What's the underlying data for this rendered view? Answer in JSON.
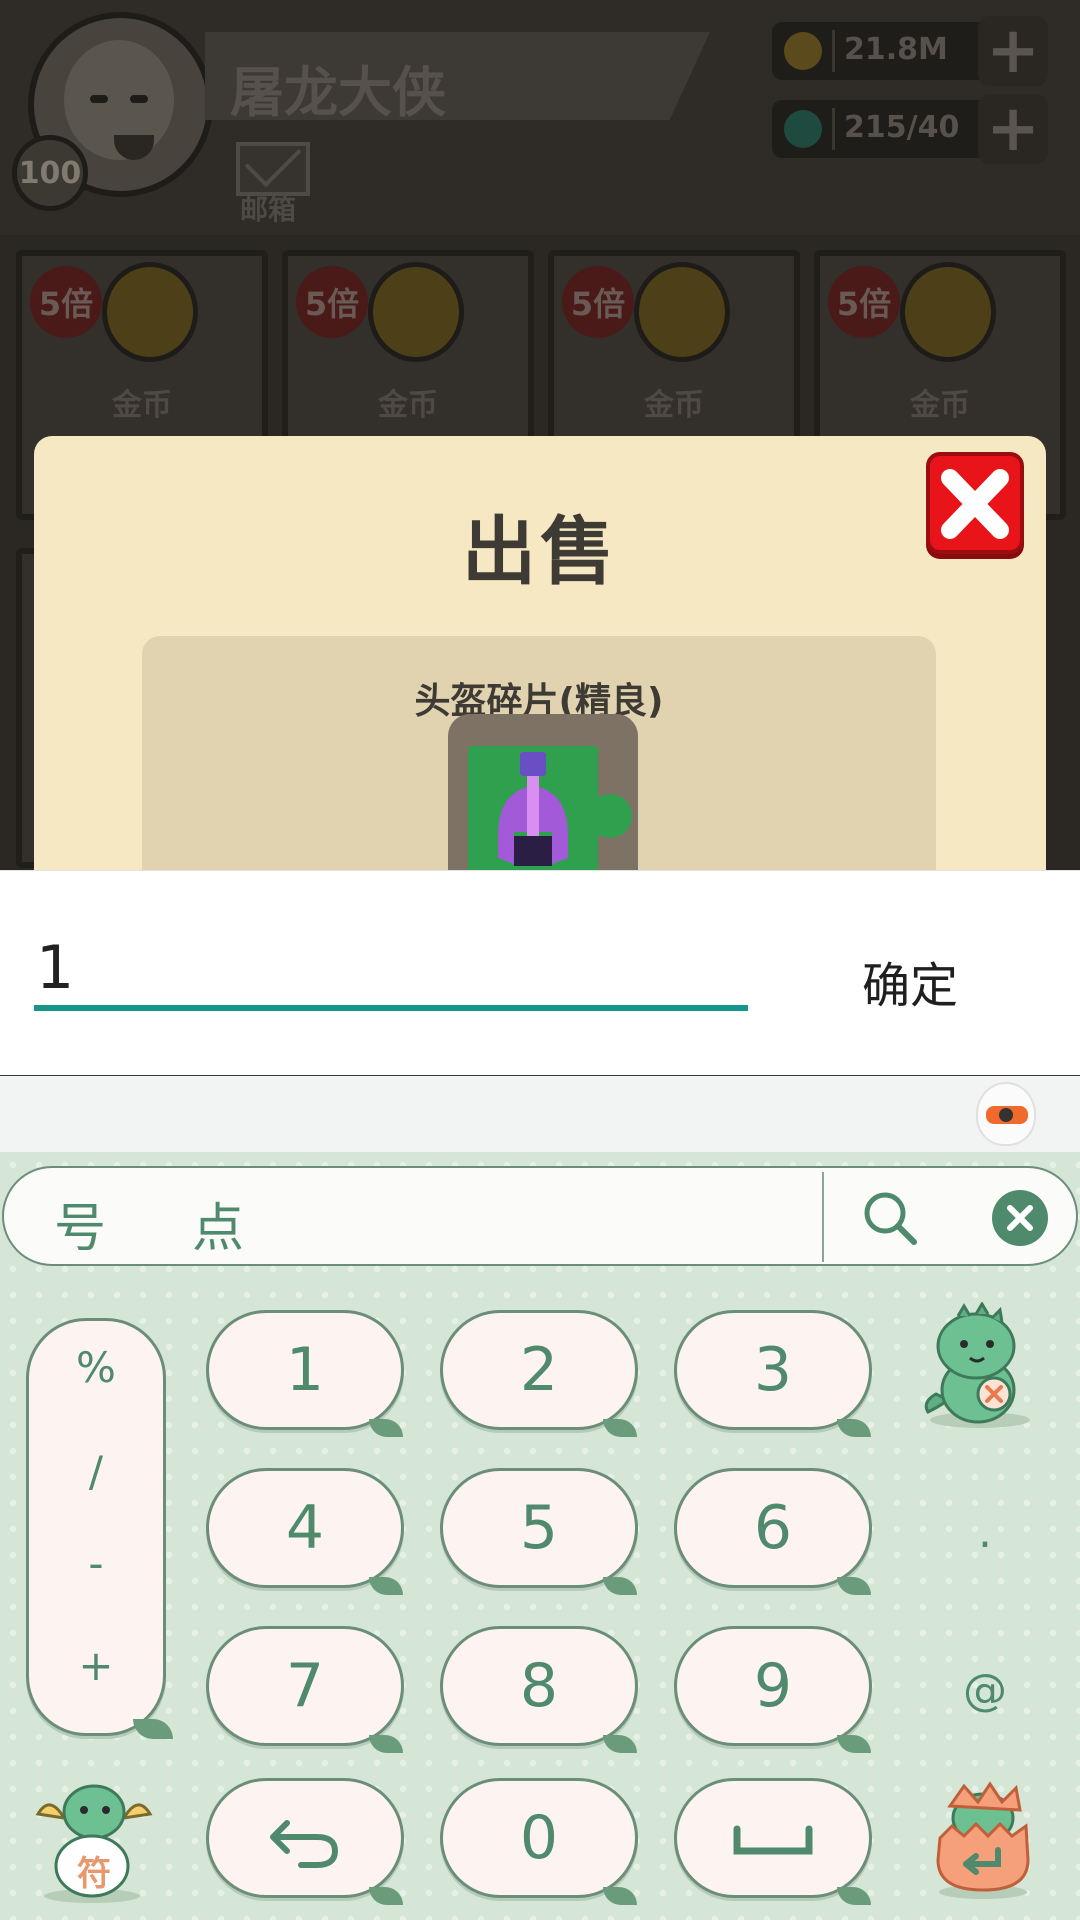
{
  "game": {
    "player_name": "屠龙大侠",
    "level": "100",
    "mail_label": "邮箱",
    "gold": "21.8M",
    "gems": "215/40",
    "shop_cards": [
      {
        "badge": "5倍",
        "label": "金币"
      },
      {
        "badge": "5倍",
        "label": "金币"
      },
      {
        "badge": "5倍",
        "label": "金币"
      },
      {
        "badge": "5倍",
        "label": "金币"
      }
    ]
  },
  "dialog": {
    "title": "出售",
    "item_name": "头盔碎片(精良)"
  },
  "input_bar": {
    "value": "1",
    "confirm_label": "确定"
  },
  "keyboard": {
    "candidates": [
      "号",
      "点"
    ],
    "symbols": [
      "%",
      "/",
      "-",
      "+"
    ],
    "keys": {
      "row1": [
        "1",
        "2",
        "3"
      ],
      "row2": [
        "4",
        "5",
        "6"
      ],
      "row3": [
        "7",
        "8",
        "9"
      ],
      "zero": "0"
    },
    "side_keys": {
      "dot": ".",
      "at": "@"
    },
    "symbol_key_mark": "符",
    "accent_color": "#4f8a6c",
    "background_color": "#d6e6d6"
  }
}
